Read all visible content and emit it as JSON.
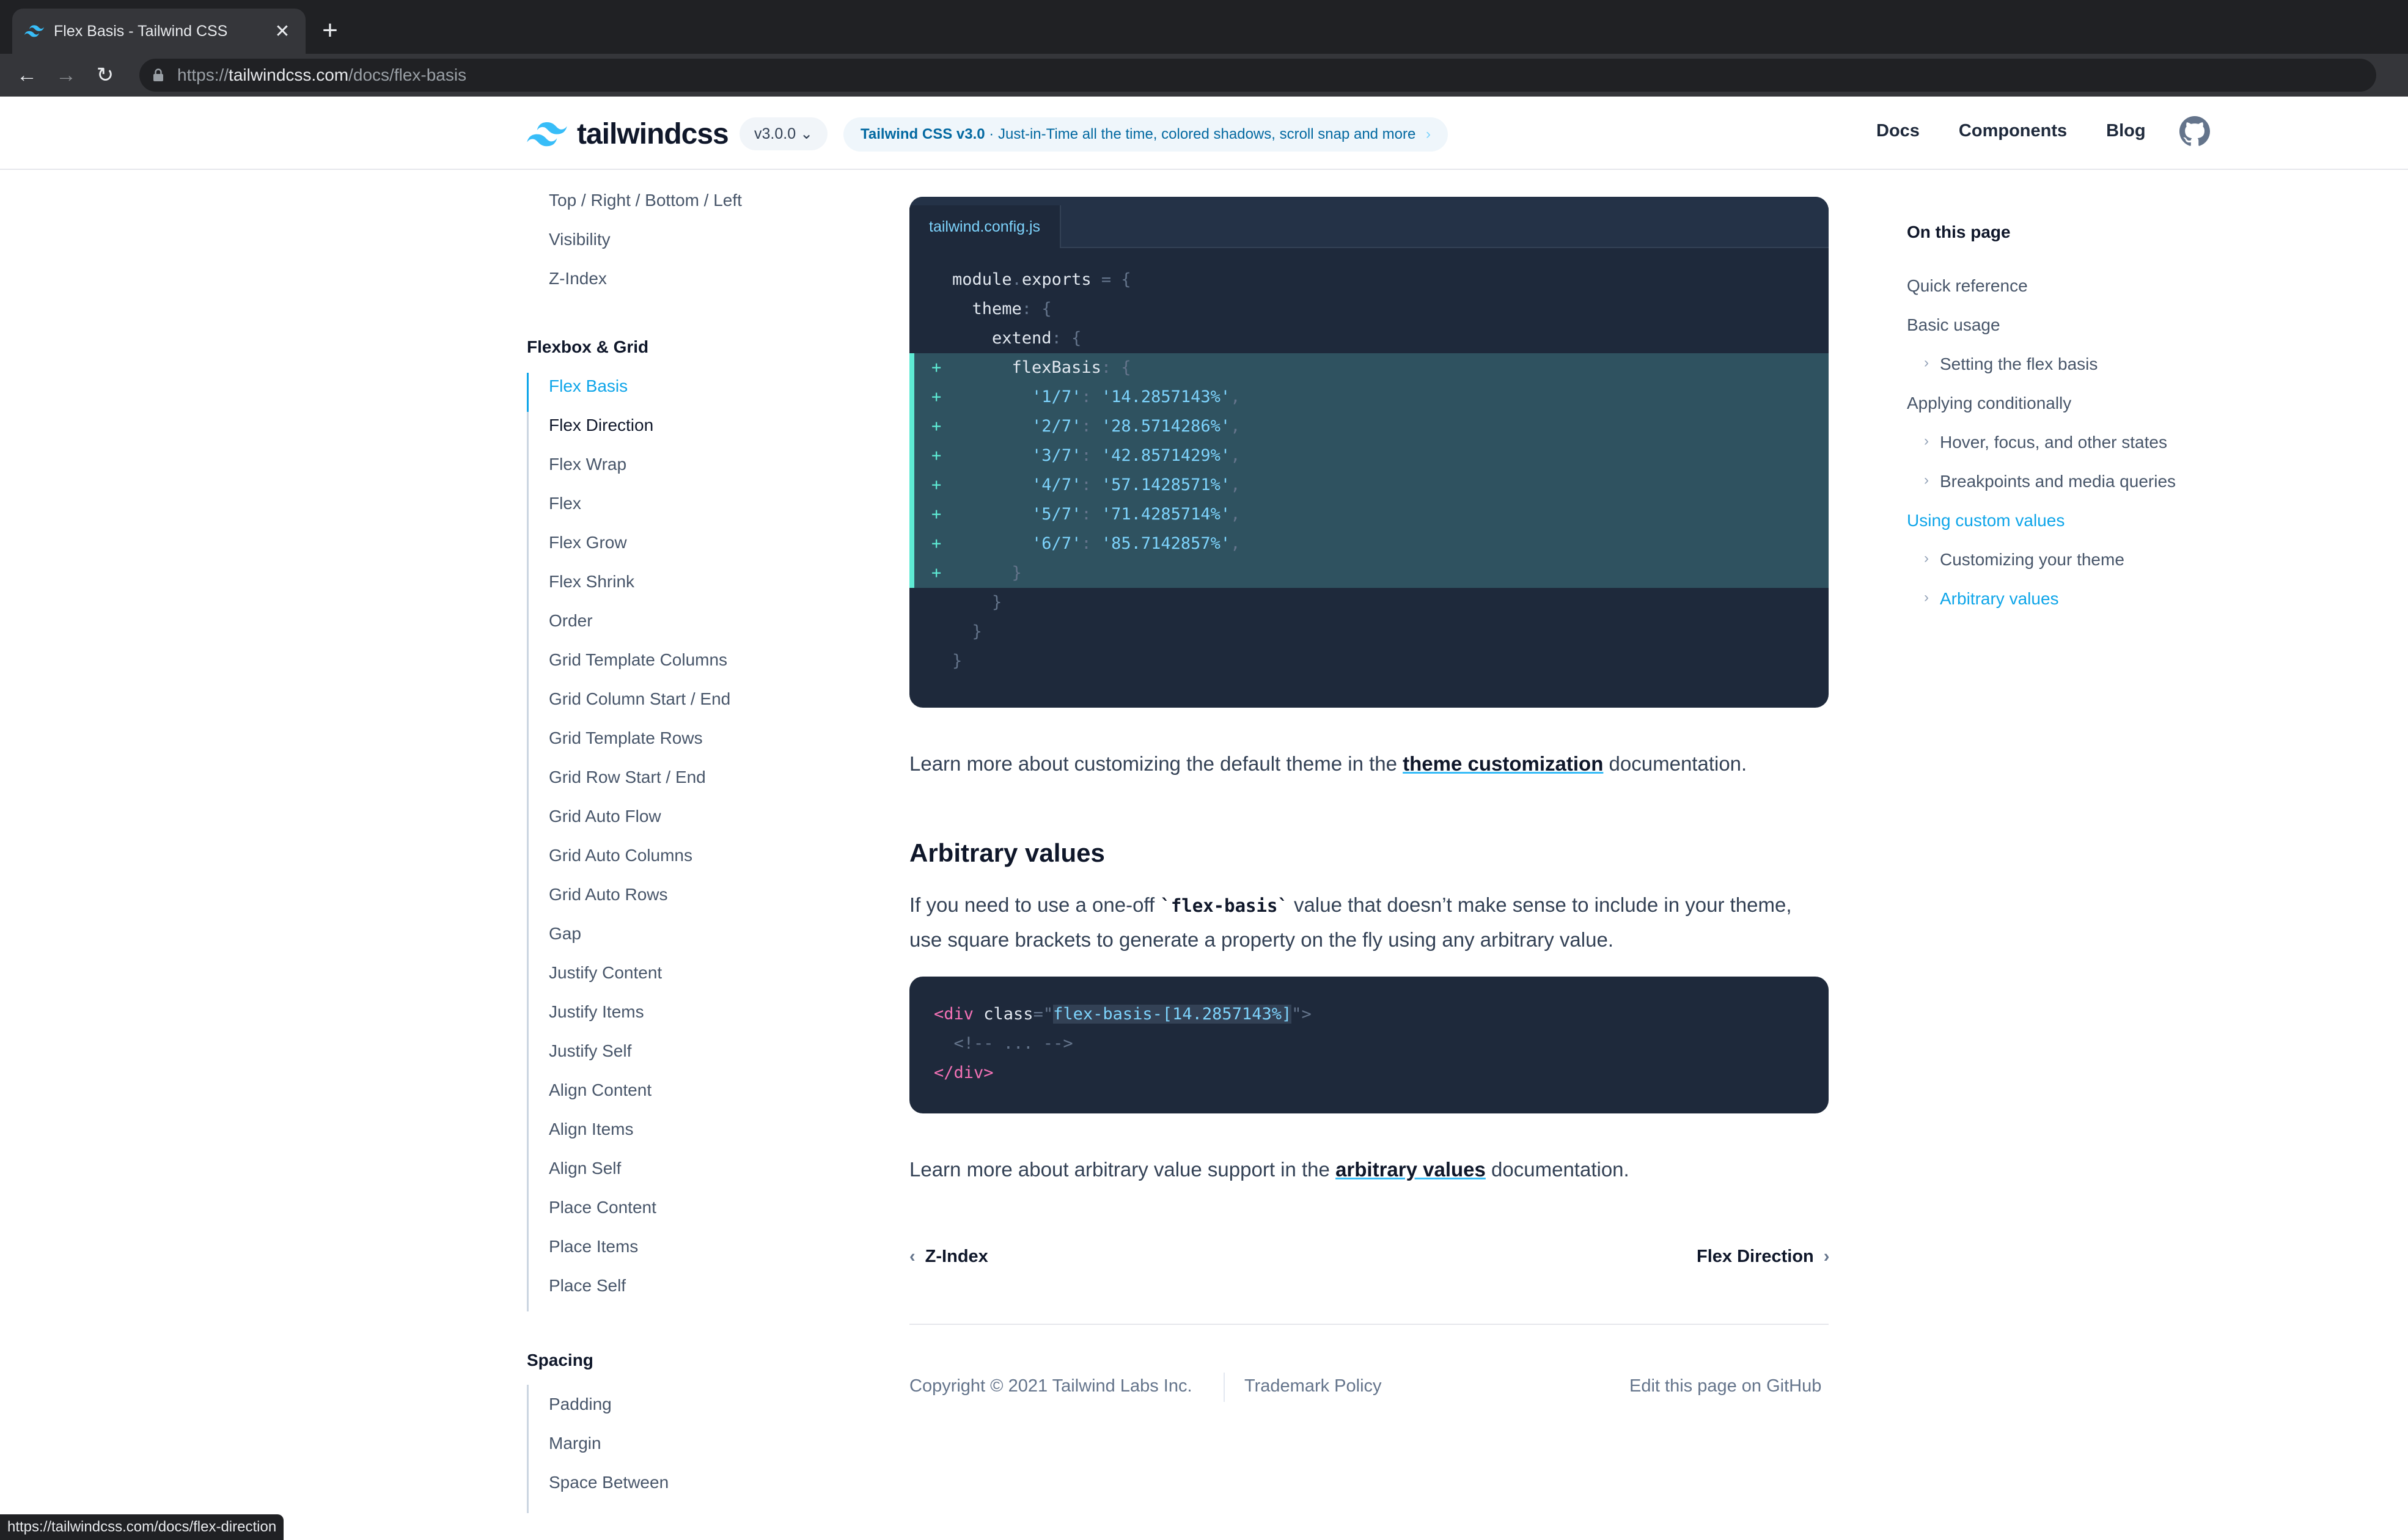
{
  "browser": {
    "tab_title": "Flex Basis - Tailwind CSS",
    "url_scheme": "https://",
    "url_host": "tailwindcss.com",
    "url_path": "/docs/flex-basis",
    "status_url": "https://tailwindcss.com/docs/flex-direction"
  },
  "header": {
    "logo_text": "tailwindcss",
    "version": "v3.0.0",
    "announce_title": "Tailwind CSS v3.0",
    "announce_dot": "·",
    "announce_text": "Just-in-Time all the time, colored shadows, scroll snap and more",
    "nav": [
      "Docs",
      "Components",
      "Blog"
    ]
  },
  "sidebar": {
    "layout_items": [
      "Top / Right / Bottom / Left",
      "Visibility",
      "Z-Index"
    ],
    "flex_heading": "Flexbox & Grid",
    "flex_items": [
      "Flex Basis",
      "Flex Direction",
      "Flex Wrap",
      "Flex",
      "Flex Grow",
      "Flex Shrink",
      "Order",
      "Grid Template Columns",
      "Grid Column Start / End",
      "Grid Template Rows",
      "Grid Row Start / End",
      "Grid Auto Flow",
      "Grid Auto Columns",
      "Grid Auto Rows",
      "Gap",
      "Justify Content",
      "Justify Items",
      "Justify Self",
      "Align Content",
      "Align Items",
      "Align Self",
      "Place Content",
      "Place Items",
      "Place Self"
    ],
    "spacing_heading": "Spacing",
    "spacing_items": [
      "Padding",
      "Margin",
      "Space Between"
    ]
  },
  "code1": {
    "filename": "tailwind.config.js",
    "lines": [
      {
        "text": "module.exports = {",
        "added": false
      },
      {
        "text": "  theme: {",
        "added": false
      },
      {
        "text": "    extend: {",
        "added": false
      },
      {
        "text": "      flexBasis: {",
        "added": true
      },
      {
        "text": "        '1/7': '14.2857143%',",
        "added": true
      },
      {
        "text": "        '2/7': '28.5714286%',",
        "added": true
      },
      {
        "text": "        '3/7': '42.8571429%',",
        "added": true
      },
      {
        "text": "        '4/7': '57.1428571%',",
        "added": true
      },
      {
        "text": "        '5/7': '71.4285714%',",
        "added": true
      },
      {
        "text": "        '6/7': '85.7142857%',",
        "added": true
      },
      {
        "text": "      }",
        "added": true
      },
      {
        "text": "    }",
        "added": false
      },
      {
        "text": "  }",
        "added": false
      },
      {
        "text": "}",
        "added": false
      }
    ]
  },
  "content": {
    "p1_before": "Learn more about customizing the default theme in the ",
    "p1_link": "theme customization",
    "p1_after": " documentation.",
    "h2": "Arbitrary values",
    "p2_a": "If you need to use a one-off ",
    "p2_code": "`flex-basis`",
    "p2_b": " value that doesn’t make sense to include in your theme,",
    "p2_c": "use square brackets to generate a property on the fly using any arbitrary value.",
    "code2_line1_open": "<div",
    "code2_line1_attr": " class",
    "code2_line1_eq": "=\"",
    "code2_line1_val": "flex-basis-[14.2857143%]",
    "code2_line1_close": "\">",
    "code2_line2": "  <!-- ... -->",
    "code2_line3": "</div>",
    "p3_before": "Learn more about arbitrary value support in the ",
    "p3_link": "arbitrary values",
    "p3_after": " documentation.",
    "prev": "Z-Index",
    "next": "Flex Direction"
  },
  "footer": {
    "copyright": "Copyright © 2021 Tailwind Labs Inc.",
    "trademark": "Trademark Policy",
    "edit": "Edit this page on GitHub"
  },
  "toc": {
    "heading": "On this page",
    "items": [
      {
        "label": "Quick reference",
        "level": 0,
        "active": false
      },
      {
        "label": "Basic usage",
        "level": 0,
        "active": false
      },
      {
        "label": "Setting the flex basis",
        "level": 1,
        "active": false
      },
      {
        "label": "Applying conditionally",
        "level": 0,
        "active": false
      },
      {
        "label": "Hover, focus, and other states",
        "level": 1,
        "active": false
      },
      {
        "label": "Breakpoints and media queries",
        "level": 1,
        "active": false
      },
      {
        "label": "Using custom values",
        "level": 0,
        "active": true
      },
      {
        "label": "Customizing your theme",
        "level": 1,
        "active": false
      },
      {
        "label": "Arbitrary values",
        "level": 1,
        "active": true
      }
    ]
  },
  "colors": {
    "accent": "#0ea5e9",
    "code_bg": "#1e293b",
    "added_bg": "#2f5260",
    "chrome_bg": "#202124"
  }
}
